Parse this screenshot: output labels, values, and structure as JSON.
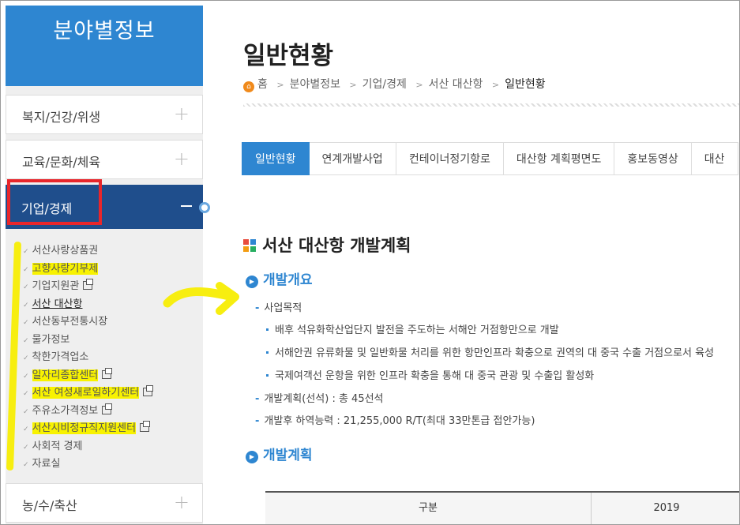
{
  "sidebar": {
    "title": "분야별정보",
    "menu": {
      "welfare": "복지/건강/위생",
      "education": "교육/문화/체육",
      "economy": "기업/경제",
      "agriculture": "농/수/축산"
    },
    "submenu": [
      "서산사랑상품권",
      "고향사랑기부제",
      "기업지원관",
      "서산 대산항",
      "서산동부전통시장",
      "물가정보",
      "착한가격업소",
      "일자리종합센터",
      "서산 여성새로일하기센터",
      "주유소가격정보",
      "서산시비정규직지원센터",
      "사회적 경제",
      "자료실"
    ]
  },
  "page": {
    "title": "일반현황",
    "breadcrumb": [
      "홈",
      "분야별정보",
      "기업/경제",
      "서산 대산항",
      "일반현황"
    ]
  },
  "tabs": [
    "일반현황",
    "연계개발사업",
    "컨테이너정기항로",
    "대산항 계획평면도",
    "홍보동영상",
    "대산"
  ],
  "content": {
    "section_title": "서산 대산항 개발계획",
    "overview_title": "개발개요",
    "purpose_label": "사업목적",
    "bullets": [
      "배후 석유화학산업단지 발전을 주도하는 서해안 거점항만으로 개발",
      "서해안권 유류화물 및 일반화물 처리를 위한 항만인프라 확충으로 권역의 대 중국 수출 거점으로서 육성",
      "국제여객선 운항을 위한 인프라 확충을 통해 대 중국 관광 및 수출입 활성화"
    ],
    "plan_line": "개발계획(선석) : 총 45선석",
    "capacity_line": "개발후 하역능력 : 21,255,000 R/T(최대 33만톤급 접안가능)",
    "plan_title": "개발계획",
    "table_header": [
      "구분",
      "2019"
    ]
  },
  "colors": {
    "brand_blue": "#2e86d1",
    "active_menu": "#1f4e8c",
    "highlight": "#f8f200",
    "annotation_red": "#e8262b"
  }
}
